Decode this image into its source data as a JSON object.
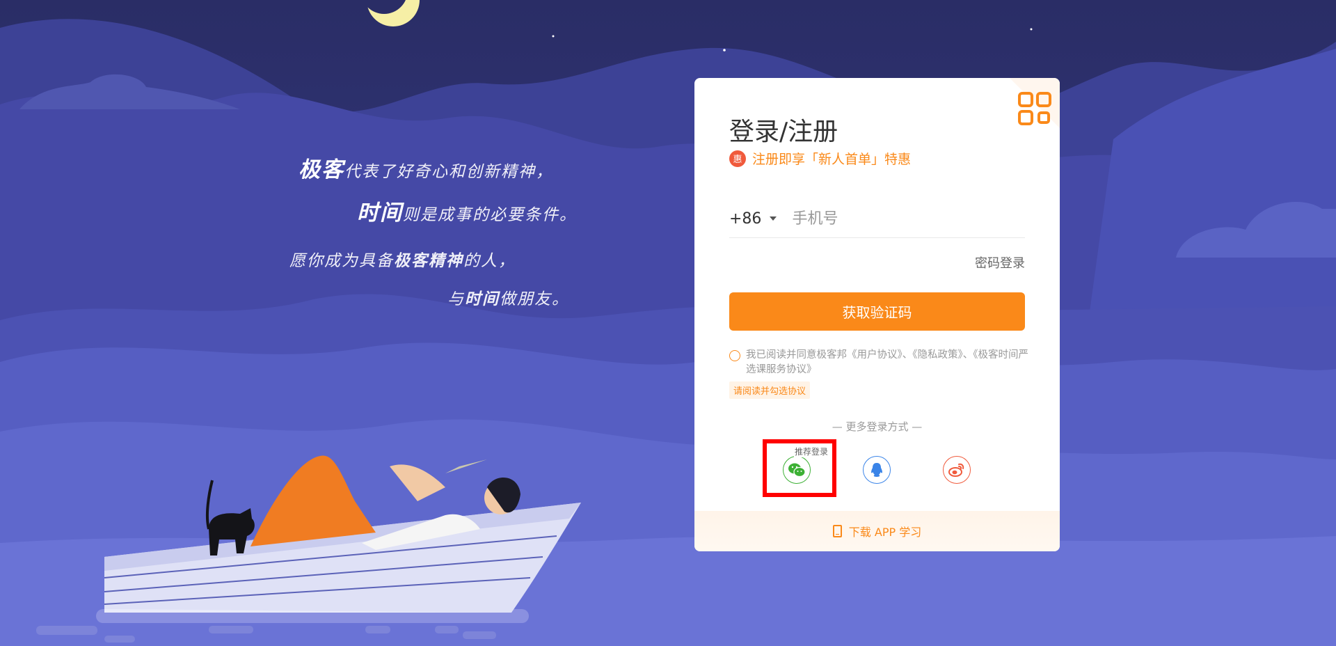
{
  "slogan": {
    "line1_bold": "极客",
    "line1_rest": "代表了好奇心和创新精神，",
    "line2_bold": "时间",
    "line2_rest": "则是成事的必要条件。",
    "line3_a": "愿你成为具备",
    "line3_bold": "极客精神",
    "line3_b": "的人，",
    "line4_a": "与",
    "line4_bold": "时间",
    "line4_b": "做朋友。"
  },
  "login": {
    "title": "登录/注册",
    "promo_badge": "惠",
    "promo_text": "注册即享「新人首单」特惠",
    "country_code": "+86",
    "phone_placeholder": "手机号",
    "password_login": "密码登录",
    "get_code_button": "获取验证码",
    "agreement_prefix": "我已阅读并同意极客邦",
    "agreement_user": "《用户协议》",
    "sep1": "、",
    "agreement_privacy": "《隐私政策》",
    "sep2": "、",
    "agreement_course": "《极客时间严选课服务协议》",
    "agreement_warning": "请阅读并勾选协议",
    "more_methods": "— 更多登录方式 —",
    "recommended": "推荐登录",
    "download_app": "下载 APP 学习"
  },
  "colors": {
    "accent": "#fa8919",
    "wechat": "#3cb034",
    "qq": "#3a84e8",
    "weibo": "#f05a3c",
    "sky": "#2b2f6e",
    "highlight": "#ff0000"
  },
  "icons": [
    "qrcode-icon",
    "wechat-icon",
    "qq-icon",
    "weibo-icon",
    "phone-icon",
    "moon-icon",
    "cat-icon",
    "boat-icon"
  ]
}
